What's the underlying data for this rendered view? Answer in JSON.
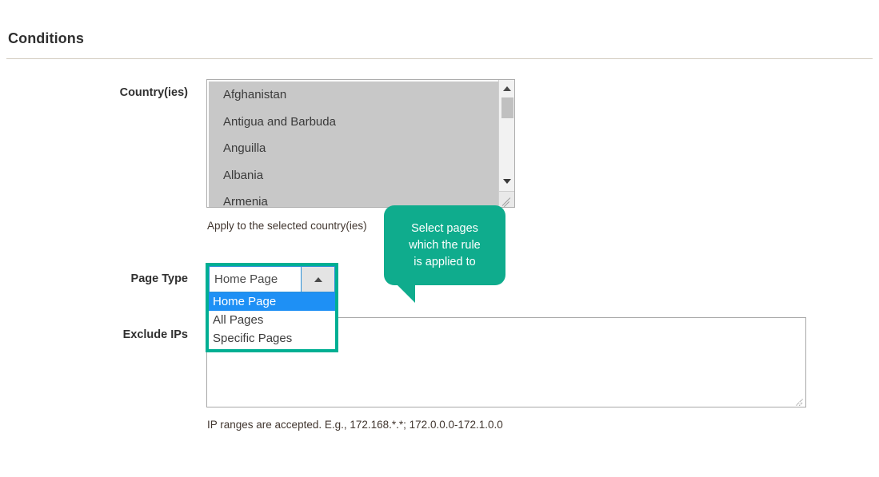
{
  "section": {
    "title": "Conditions"
  },
  "fields": {
    "countries": {
      "label": "Country(ies)",
      "hint": "Apply to the selected country(ies)",
      "options": [
        "Afghanistan",
        "Antigua and Barbuda",
        "Anguilla",
        "Albania",
        "Armenia"
      ],
      "scrollbar": {
        "up_arrow_icon": "triangle-up-icon",
        "down_arrow_icon": "triangle-down-icon",
        "resize_icon": "resize-grip-icon"
      }
    },
    "page_type": {
      "label": "Page Type",
      "value": "Home Page",
      "expanded": true,
      "arrow_icon": "triangle-up-icon",
      "options": [
        {
          "label": "Home Page",
          "selected": true
        },
        {
          "label": "All Pages",
          "selected": false
        },
        {
          "label": "Specific Pages",
          "selected": false
        }
      ]
    },
    "exclude_ips": {
      "label": "Exclude IPs",
      "value": "",
      "hint": "IP ranges are accepted. E.g., 172.168.*.*; 172.0.0.0-172.1.0.0",
      "resize_icon": "resize-grip-icon"
    }
  },
  "tooltip": {
    "text": "Select pages\nwhich the rule\nis applied to"
  },
  "colors": {
    "accent_teal": "#0fac8d",
    "focus_outline": "#00af93",
    "selection_blue": "#1e90f5",
    "divider": "#d3cbbf",
    "label_text": "#303030",
    "listbox_bg": "#c8c8c8"
  }
}
